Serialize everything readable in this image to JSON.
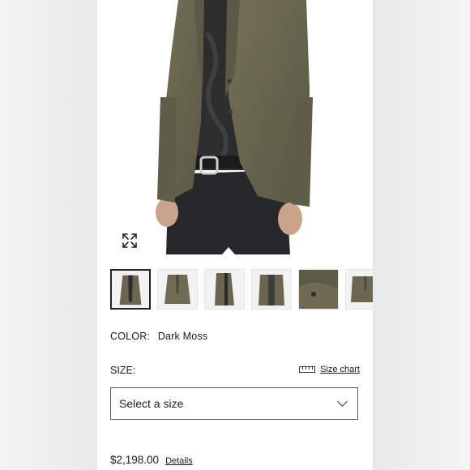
{
  "product": {
    "color_label": "COLOR:",
    "color_value": "Dark Moss",
    "size_label": "SIZE:",
    "size_chart_label": "Size chart",
    "size_select": {
      "selected": "Select a size"
    },
    "price": "$2,198.00",
    "details_label": "Details"
  },
  "gallery": {
    "thumbnails": [
      {
        "view": "front-worn",
        "selected": true
      },
      {
        "view": "front-flat",
        "selected": false
      },
      {
        "view": "side-worn",
        "selected": false
      },
      {
        "view": "open-worn",
        "selected": false
      },
      {
        "view": "detail-closeup",
        "selected": false
      },
      {
        "view": "flat-lay",
        "selected": false
      }
    ]
  },
  "icons": {
    "expand": "expand-arrows-icon",
    "ruler": "ruler-icon",
    "dropdown": "chevron-down-icon"
  },
  "colors": {
    "jacket": "#6a6650",
    "jacket_dark": "#4c4a3a",
    "shirt": "#2a2d2c",
    "jeans": "#25272b",
    "skin": "#c9a48a"
  }
}
